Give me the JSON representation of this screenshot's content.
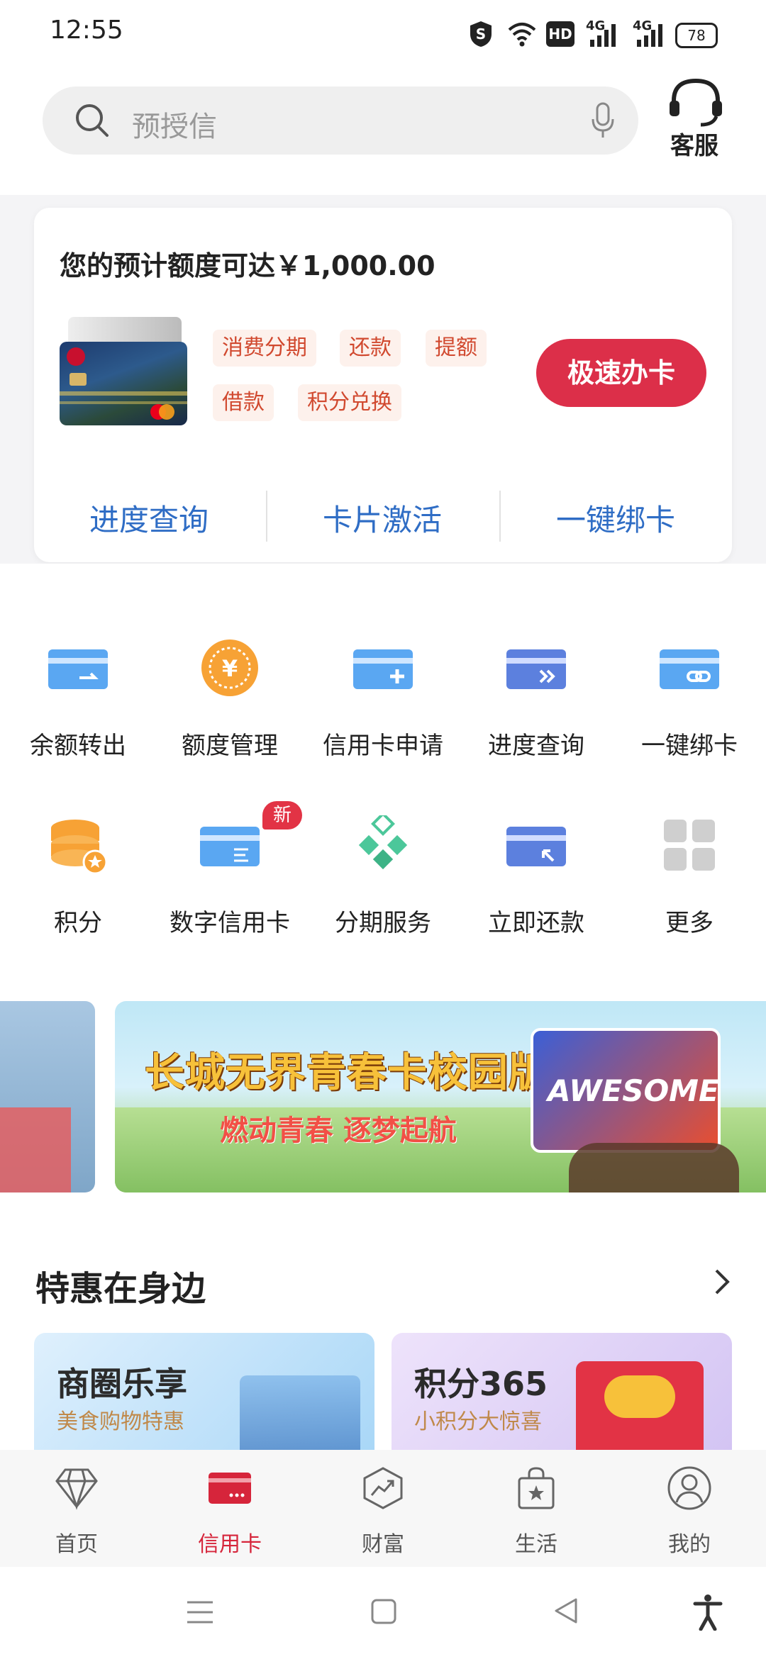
{
  "status_bar": {
    "time": "12:55",
    "hd_label": "HD",
    "signal_label_1": "4G",
    "signal_label_2": "4G",
    "battery": "78"
  },
  "header": {
    "search_placeholder": "预授信",
    "customer_service_label": "客服"
  },
  "card": {
    "quota_text": "您的预计额度可达￥1,000.00",
    "tags": [
      "消费分期",
      "还款",
      "提额",
      "借款",
      "积分兑换"
    ],
    "apply_button": "极速办卡",
    "quick_links": [
      "进度查询",
      "卡片激活",
      "一键绑卡"
    ]
  },
  "grid": {
    "row1": [
      "余额转出",
      "额度管理",
      "信用卡申请",
      "进度查询",
      "一键绑卡"
    ],
    "row2": [
      "积分",
      "数字信用卡",
      "分期服务",
      "立即还款",
      "更多"
    ],
    "new_badge": "新"
  },
  "banner": {
    "title": "长城无界青春卡校园版",
    "subtitle": "燃动青春 逐梦起航",
    "card_text": "AWESOME"
  },
  "section": {
    "title": "特惠在身边",
    "promos": [
      {
        "title": "商圈乐享",
        "subtitle": "美食购物特惠"
      },
      {
        "title": "积分365",
        "subtitle": "小积分大惊喜"
      }
    ]
  },
  "tabbar": {
    "tabs": [
      "首页",
      "信用卡",
      "财富",
      "生活",
      "我的"
    ],
    "active_index": 1
  },
  "colors": {
    "brand_red": "#dc2f49",
    "link_blue": "#2f6dc5",
    "tag_text": "#d1492f"
  }
}
